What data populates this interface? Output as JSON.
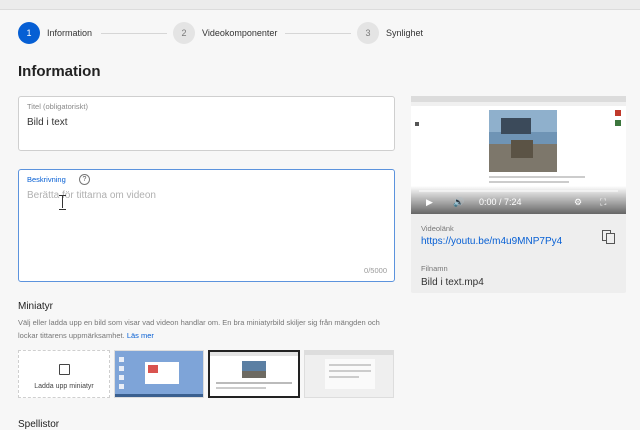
{
  "stepper": {
    "steps": [
      {
        "number": "1",
        "label": "Information",
        "state": "active"
      },
      {
        "number": "2",
        "label": "Videokomponenter",
        "state": "inactive"
      },
      {
        "number": "3",
        "label": "Synlighet",
        "state": "inactive"
      }
    ]
  },
  "page": {
    "heading": "Information"
  },
  "title_field": {
    "label": "Titel (obligatoriskt)",
    "value": "Bild i text"
  },
  "description_field": {
    "label": "Beskrivning",
    "help_icon": "?",
    "placeholder": "Berätta för tittarna om videon",
    "counter": "0/5000"
  },
  "thumbnails": {
    "title": "Miniatyr",
    "description": "Välj eller ladda upp en bild som visar vad videon handlar om. En bra miniatyrbild skiljer sig från mängden och lockar tittarens uppmärksamhet.",
    "learn_more": "Läs mer",
    "upload_label": "Ladda upp miniatyr"
  },
  "playlists": {
    "title": "Spellistor"
  },
  "preview": {
    "time": "0:00 / 7:24",
    "video_link_label": "Videolänk",
    "video_link": "https://youtu.be/m4u9MNP7Py4",
    "filename_label": "Filnamn",
    "filename": "Bild i text.mp4"
  },
  "colors": {
    "accent": "#065fd4",
    "background": "#f7f7f7"
  }
}
